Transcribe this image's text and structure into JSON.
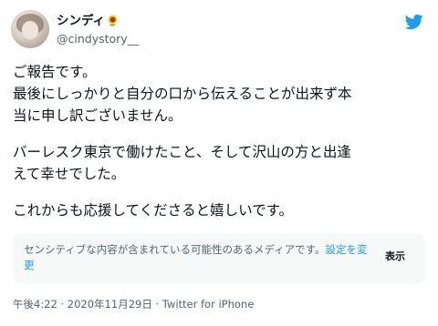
{
  "tweet": {
    "display_name": "シンディ",
    "name_emoji": "🌻",
    "handle": "@cindystory__",
    "paragraphs": [
      [
        "ご報告です。",
        "最後にしっかりと自分の口から伝えることが出来ず本",
        "当に申し訳ございません。"
      ],
      [
        "バーレスク東京で働けたこと、そして沢山の方と出逢",
        "えて幸せでした。"
      ],
      [
        "これからも応援してくださると嬉しいです。"
      ]
    ],
    "sensitive_notice": {
      "text": "センシティブな内容が含まれている可能性のあるメディアです。",
      "settings_link": "設定を変更",
      "show_label": "表示"
    },
    "timestamp": "午後4:22 · 2020年11月29日 · Twitter for iPhone"
  },
  "icons": {
    "logo": "twitter-bird-icon"
  },
  "colors": {
    "brand": "#1d9bf0",
    "text": "#0f1419",
    "secondary": "#536471",
    "notice_bg": "#f7f9f9"
  }
}
